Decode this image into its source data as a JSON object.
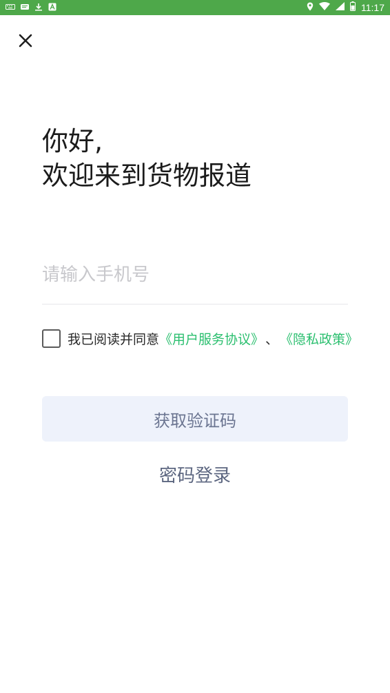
{
  "status_bar": {
    "time": "11:17",
    "left_icons": [
      "keyboard-icon",
      "message-icon",
      "download-icon",
      "a-icon"
    ],
    "right_icons": [
      "location-icon",
      "wifi-icon",
      "signal-icon",
      "battery-icon"
    ],
    "color": "#4ea84a"
  },
  "header": {
    "close_icon": "close-icon",
    "close_glyph": "✕"
  },
  "greeting": {
    "line1": "你好,",
    "line2": "欢迎来到货物报道"
  },
  "phone": {
    "placeholder": "请输入手机号",
    "value": ""
  },
  "agreement": {
    "checked": false,
    "prefix": "我已阅读并同意",
    "user_agreement": "《用户服务协议》",
    "separator": "、",
    "privacy_policy": "《隐私政策》",
    "link_color": "#2bbf6f"
  },
  "actions": {
    "get_code": "获取验证码",
    "password_login": "密码登录"
  }
}
